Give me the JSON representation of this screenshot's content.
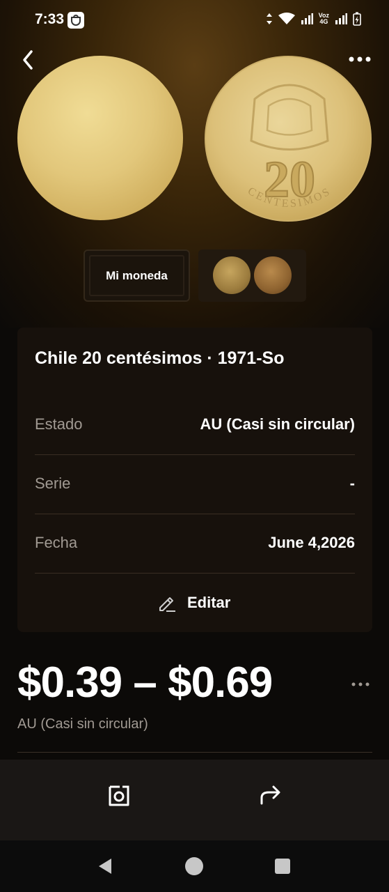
{
  "status_bar": {
    "time": "7:33",
    "network_label_top": "Voz",
    "network_label_bottom": "4G",
    "icons": [
      "bag-icon",
      "data-arrows-icon",
      "wifi-icon",
      "signal-icon",
      "signal-icon",
      "battery-charging-icon"
    ]
  },
  "header": {
    "back_icon": "chevron-left-icon",
    "more_icon": "more-horizontal-icon"
  },
  "gallery": {
    "tabs": [
      {
        "label": "Mi moneda"
      }
    ],
    "coin_text_numeral": "20",
    "coin_text_legend": "CENTESIMOS"
  },
  "details": {
    "title": "Chile 20 centésimos · 1971-So",
    "rows": [
      {
        "label": "Estado",
        "value": "AU (Casi sin circular)"
      },
      {
        "label": "Serie",
        "value": "-"
      },
      {
        "label": "Fecha",
        "value": "June 4,2026"
      }
    ],
    "edit_label": "Editar",
    "edit_icon": "pencil-icon"
  },
  "price": {
    "range": "$0.39 – $0.69",
    "condition": "AU (Casi sin circular)"
  },
  "action_bar": {
    "icons": [
      "camera-icon",
      "share-icon"
    ]
  },
  "colors": {
    "background": "#0c0a08",
    "card": "#17110c",
    "muted_text": "#a19a93",
    "coin_gold": "#dcc079"
  }
}
